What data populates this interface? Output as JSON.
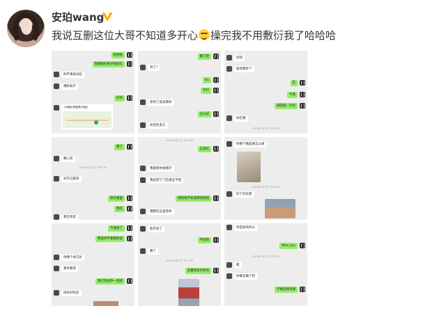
{
  "post": {
    "username": "安珀wang",
    "text_before": "我说互删这位大哥不知道多开心",
    "text_after": "操完我不用敷衍我了哈哈哈",
    "emoji": "grinning-emoji",
    "verified_icon": "verified-badge-icon"
  },
  "screens": [
    {
      "messages": [
        {
          "side": "right",
          "text": "哈哈哈"
        },
        {
          "side": "right",
          "text": "你跟我的妹子跑饭吃"
        },
        {
          "side": "left",
          "text": "你不来再也吃"
        },
        {
          "side": "left",
          "text": "哦好妹子"
        },
        {
          "side": "right",
          "text": "好的"
        },
        {
          "side": "left",
          "text": "上海建业里嘉佩乐酒店"
        }
      ]
    },
    {
      "messages": [
        {
          "side": "right",
          "text": "撤了吧"
        },
        {
          "side": "left",
          "text": "到了?"
        },
        {
          "side": "right",
          "text": "Bu"
        },
        {
          "side": "right",
          "text": "不行"
        },
        {
          "side": "left",
          "text": "你到了再去摸你"
        },
        {
          "side": "right",
          "text": "这么好"
        },
        {
          "side": "left",
          "text": "你还有多久"
        }
      ],
      "timestamp": "2021年7月7日 下午3:25"
    },
    {
      "messages": [
        {
          "side": "left",
          "text": "好呀"
        },
        {
          "side": "left",
          "text": "给你我弄个"
        },
        {
          "side": "right",
          "text": "在"
        },
        {
          "side": "right",
          "text": "不来"
        },
        {
          "side": "right",
          "text": "再回复一点点"
        },
        {
          "side": "left",
          "text": "你在哪"
        }
      ],
      "timestamp": "2021年7月7日 下午4:30"
    },
    {
      "messages": [
        {
          "side": "right",
          "text": "我了"
        },
        {
          "side": "left",
          "text": "喔儿哥"
        },
        {
          "side": "left",
          "text": "对方已取消"
        },
        {
          "side": "right",
          "text": "你在哪里"
        },
        {
          "side": "right",
          "text": "我在"
        },
        {
          "side": "left",
          "text": "我在附近"
        }
      ],
      "timestamp": "2021年7月7日 下午4:20"
    },
    {
      "messages": [
        {
          "side": "right",
          "text": "王发红"
        },
        {
          "side": "left",
          "text": "我能和你发帽子"
        },
        {
          "side": "left",
          "text": "我说到了门店来这不错"
        },
        {
          "side": "right",
          "text": "哈哈哈不知道呀哈哈哈"
        },
        {
          "side": "left",
          "text": "哦我在这里等你"
        }
      ],
      "timestamp": "2021年7月7日 下午4:43"
    },
    {
      "messages": [
        {
          "side": "left",
          "text": "你那个看起来怎么样"
        },
        {
          "side": "left",
          "text": "好了的东西"
        }
      ],
      "timestamp": "2021年7月7日 下午5:40"
    },
    {
      "messages": [
        {
          "side": "right",
          "text": "不准搞了"
        },
        {
          "side": "right",
          "text": "我说你不要跟你说"
        },
        {
          "side": "left",
          "text": "你哪个地方好"
        },
        {
          "side": "left",
          "text": "我有看得"
        },
        {
          "side": "right",
          "text": "我们等会你一直找"
        },
        {
          "side": "left",
          "text": "你好好吃的"
        }
      ],
      "timestamp": "2021年7月7日 下午7:32"
    },
    {
      "messages": [
        {
          "side": "left",
          "text": "新开会了"
        },
        {
          "side": "right",
          "text": "不会吧"
        },
        {
          "side": "left",
          "text": "算了"
        },
        {
          "side": "right",
          "text": "宝藏男孩买你的"
        }
      ],
      "timestamp": "2021年7月7日 下午7:40"
    },
    {
      "messages": [
        {
          "side": "left",
          "text": "你是很有的么"
        },
        {
          "side": "right",
          "text": "Miss you"
        },
        {
          "side": "left",
          "text": "嗯"
        },
        {
          "side": "left",
          "text": "你做又做了吧"
        },
        {
          "side": "right",
          "text": "不要这样对我"
        }
      ],
      "timestamp": "2021年7月7日 下午7:55"
    }
  ]
}
